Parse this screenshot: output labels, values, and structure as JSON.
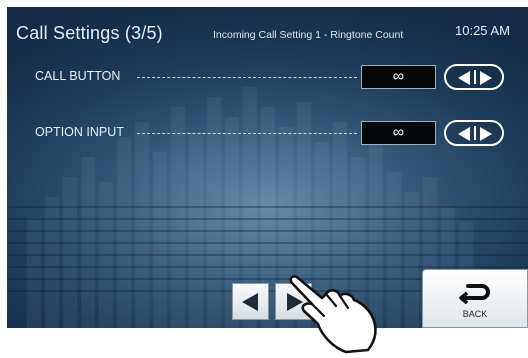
{
  "header": {
    "title": "Call Settings (3/5)",
    "subtitle": "Incoming Call Setting 1 - Ringtone Count",
    "time": "10:25 AM"
  },
  "rows": [
    {
      "label": "CALL BUTTON",
      "value": "∞"
    },
    {
      "label": "OPTION INPUT",
      "value": "∞"
    }
  ],
  "footer": {
    "back_label": "BACK"
  },
  "icons": {
    "row_control": "left-right-arrows-icon",
    "prev": "triangle-left-icon",
    "next": "triangle-right-icon",
    "back": "return-arrow-icon",
    "pointer": "pointing-hand-icon"
  },
  "colors": {
    "background": "#1d3a57",
    "value_box": "#050607",
    "text": "#e6eef6"
  }
}
